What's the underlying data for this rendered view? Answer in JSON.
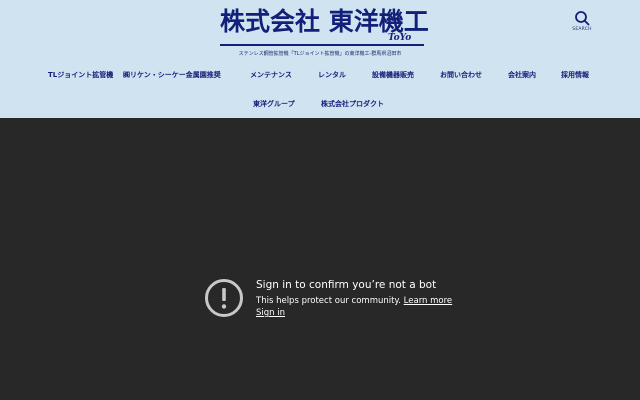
{
  "header": {
    "logo_text": "株式会社 東洋機工",
    "logo_sub": "ToYo",
    "tagline": "ステンレス鋼管拡管機「TLジョイント拡管機」の東洋機工-群馬県沼田市",
    "search_label": "SEARCH",
    "bg_color": "#cfe3f1",
    "text_color": "#13207a"
  },
  "nav": {
    "items": [
      {
        "label": "TLジョイント拡管機"
      },
      {
        "label": "㈱リケン・シーケー金属園推奨"
      },
      {
        "label": "メンテナンス"
      },
      {
        "label": "レンタル"
      },
      {
        "label": "設備機器販売"
      },
      {
        "label": "お問い合わせ"
      },
      {
        "label": "会社案内"
      },
      {
        "label": "採用情報"
      },
      {
        "label": "東洋グループ"
      },
      {
        "label": "株式会社プロダクト"
      }
    ]
  },
  "video_embed": {
    "bg_color": "#282828",
    "title": "Sign in to confirm you’re not a bot",
    "desc": "This helps protect our community.",
    "learn_more": "Learn more",
    "sign_in": "Sign in"
  }
}
